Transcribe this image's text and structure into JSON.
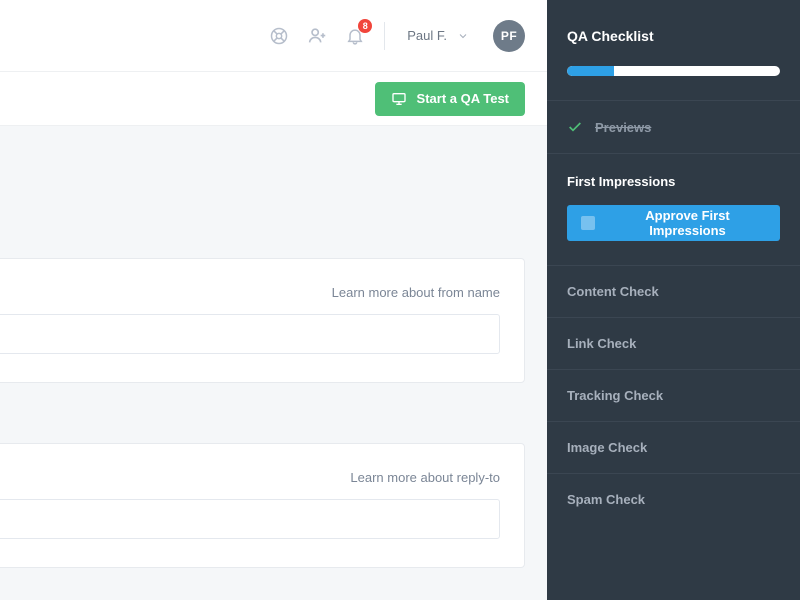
{
  "header": {
    "notification_count": "8",
    "user_name": "Paul F.",
    "avatar_initials": "PF"
  },
  "actionbar": {
    "start_qa_label": "Start a QA Test"
  },
  "main": {
    "from_name_hint": "Learn more about from name",
    "reply_to_hint": "Learn more about reply-to"
  },
  "sidebar": {
    "title": "QA Checklist",
    "progress_percent": "22",
    "done_item": "Previews",
    "active_section_title": "First Impressions",
    "approve_label": "Approve First Impressions",
    "items": [
      "Content Check",
      "Link Check",
      "Tracking Check",
      "Image Check",
      "Spam Check"
    ]
  }
}
